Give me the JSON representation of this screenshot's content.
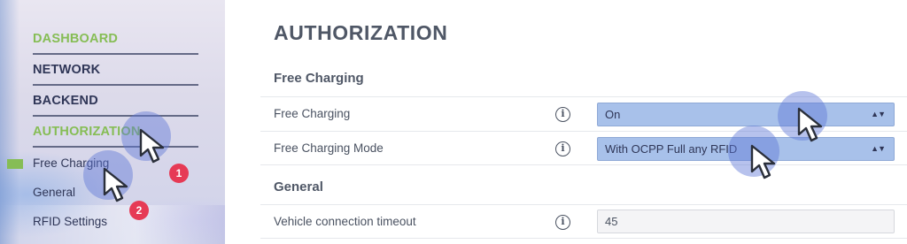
{
  "sidebar": {
    "nav": [
      {
        "label": "DASHBOARD"
      },
      {
        "label": "NETWORK"
      },
      {
        "label": "BACKEND"
      },
      {
        "label": "AUTHORIZATION"
      }
    ],
    "sub_items": [
      {
        "label": "Free Charging"
      },
      {
        "label": "General"
      },
      {
        "label": "RFID Settings"
      }
    ]
  },
  "main": {
    "title": "AUTHORIZATION",
    "sections": [
      {
        "heading": "Free Charging",
        "rows": [
          {
            "label": "Free Charging",
            "value": "On"
          },
          {
            "label": "Free Charging Mode",
            "value": "With OCPP Full any RFID"
          }
        ]
      },
      {
        "heading": "General",
        "rows": [
          {
            "label": "Vehicle connection timeout",
            "value": "45"
          }
        ]
      }
    ],
    "info_icon_glyph": "i",
    "select_caret_glyph": "▲▼"
  },
  "annotations": {
    "steps": [
      "1",
      "2"
    ],
    "badge_color": "#e63a55",
    "halo_color": "#5f78d7"
  },
  "colors": {
    "active_green": "#86bd55",
    "nav_dark": "#2f3657",
    "select_fill": "#a8c1ea"
  }
}
